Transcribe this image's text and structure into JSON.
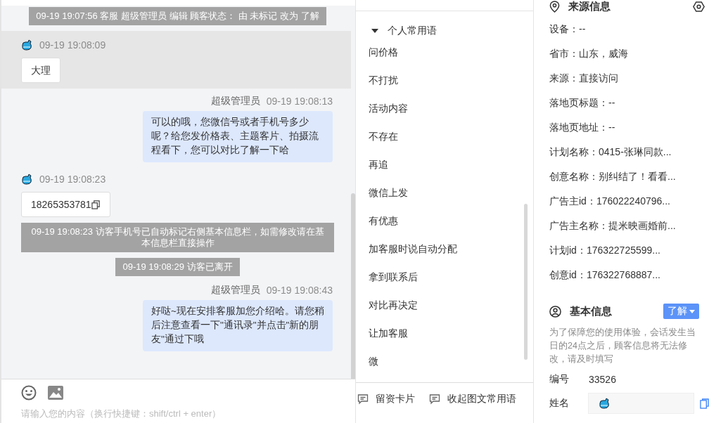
{
  "chat": {
    "messages": [
      {
        "kind": "system",
        "text": "09-19 19:07:56 客服 超级管理员 编辑 顾客状态： 由 未标记 改为 了解"
      },
      {
        "kind": "visitor",
        "time": "09-19 19:08:09",
        "text": "大理",
        "highlighted": true,
        "copyable": false
      },
      {
        "kind": "agent",
        "sender": "超级管理员",
        "time": "09-19 19:08:13",
        "text": "可以的哦，您微信号或者手机号多少呢？给您发价格表、主题客片、拍摄流程看下，您可以对比了解一下哈"
      },
      {
        "kind": "visitor",
        "time": "09-19 19:08:23",
        "text": "18265353781",
        "highlighted": false,
        "copyable": true
      },
      {
        "kind": "system",
        "text": "09-19 19:08:23 访客手机号已自动标记右侧基本信息栏，如需修改请在基本信息栏直接操作"
      },
      {
        "kind": "system",
        "text": "09-19 19:08:29 访客已离开"
      },
      {
        "kind": "agent",
        "sender": "超级管理员",
        "time": "09-19 19:08:43",
        "text": "好哒~现在安排客服加您介绍哈。请您稍后注意查看一下\"通讯录\"并点击\"新的朋友\"通过下哦"
      }
    ]
  },
  "composer": {
    "placeholder": "请输入您的内容（换行快捷键：shift/ctrl + enter）"
  },
  "phrases": {
    "header": "个人常用语",
    "expanded": true,
    "items": [
      "问价格",
      "不打扰",
      "活动内容",
      "不存在",
      "再追",
      "微信上发",
      "有优惠",
      "加客服时说自动分配",
      "拿到联系后",
      "对比再决定",
      "让加客服",
      "微"
    ],
    "footer_buttons": [
      "留资卡片",
      "收起图文常用语"
    ]
  },
  "source_info": {
    "title": "来源信息",
    "lines": [
      "设备：--",
      "省市：山东，威海",
      "来源：直接访问",
      "落地页标题：--",
      "落地页地址：--",
      "计划名称：0415-张琳同款...",
      "创意名称：别纠结了！看看...",
      "广告主id：176022240796...",
      "广告主名称：提米映画婚前...",
      "计划id：176322725599...",
      "创意id：176322768887..."
    ]
  },
  "basic_info": {
    "title": "基本信息",
    "status": "了解",
    "notice": "为了保障您的使用体验，会话发生当日的24点之后，顾客信息将无法修改，请及时填写",
    "fields": [
      {
        "kind": "text",
        "label": "编号",
        "value": "33526"
      },
      {
        "kind": "avatar_field",
        "label": "姓名"
      }
    ]
  }
}
